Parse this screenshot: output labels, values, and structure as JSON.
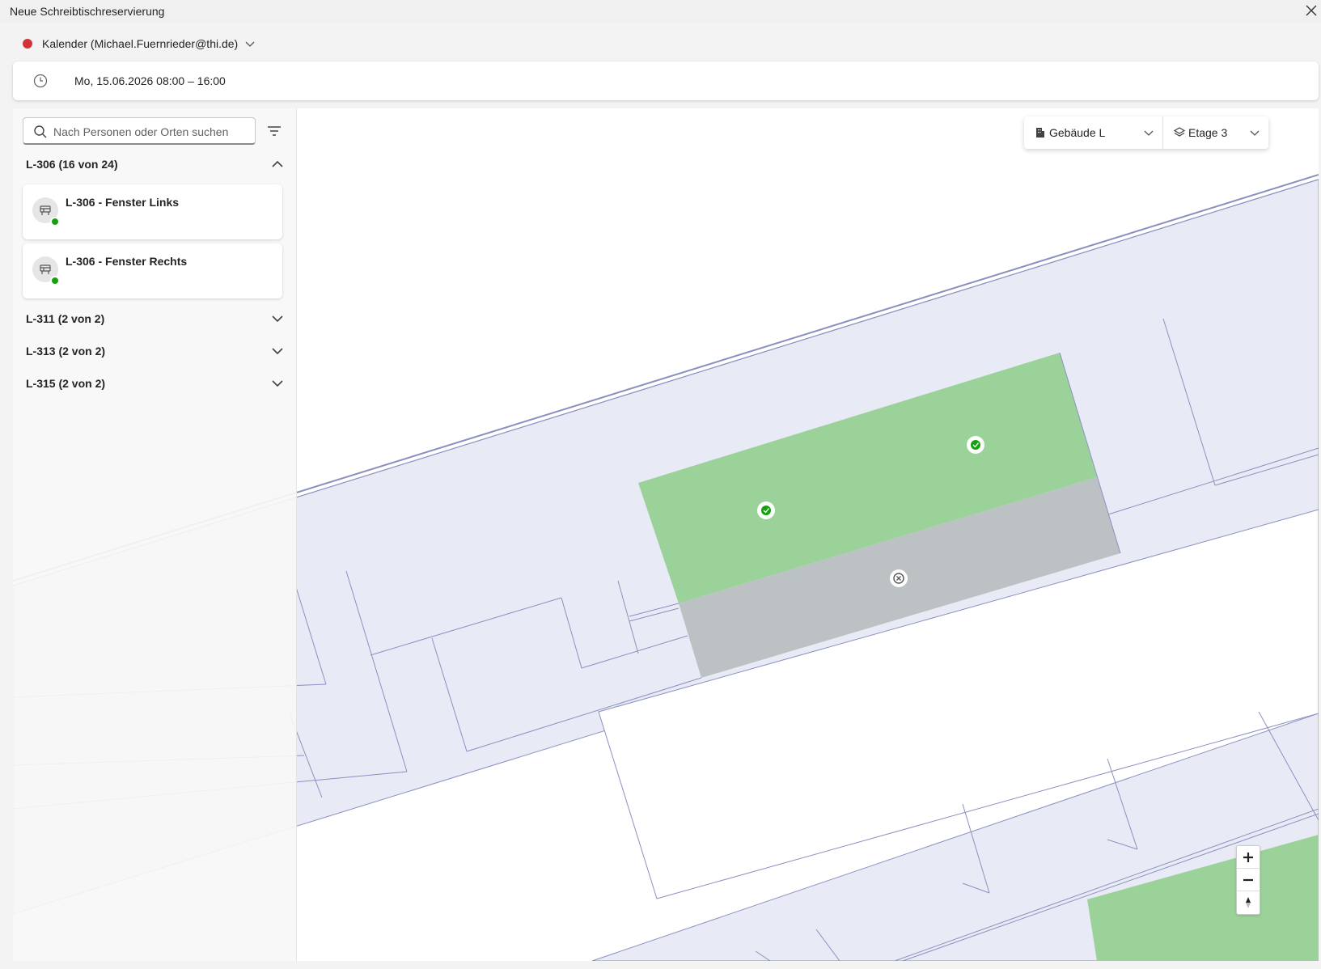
{
  "window": {
    "title": "Neue Schreibtischreservierung"
  },
  "calendar": {
    "label": "Kalender (Michael.Fuernrieder@thi.de)",
    "color": "#d13438"
  },
  "time": {
    "value": "Mo, 15.06.2026 08:00 – 16:00"
  },
  "search": {
    "placeholder": "Nach Personen oder Orten suchen"
  },
  "groups": [
    {
      "label": "L-306 (16 von 24)",
      "expanded": true
    },
    {
      "label": "L-311 (2 von 2)",
      "expanded": false
    },
    {
      "label": "L-313 (2 von 2)",
      "expanded": false
    },
    {
      "label": "L-315 (2 von 2)",
      "expanded": false
    }
  ],
  "desks": [
    {
      "label": "L-306 - Fenster Links",
      "status": "available"
    },
    {
      "label": "L-306 - Fenster Rechts",
      "status": "available"
    }
  ],
  "building": {
    "label": "Gebäude L"
  },
  "floor": {
    "label": "Etage 3"
  },
  "map": {
    "available_color": "#9bd29a",
    "occupied_color": "#bcc2c4",
    "room_fill": "#e8ebf5",
    "line_color": "#8b90c0"
  }
}
